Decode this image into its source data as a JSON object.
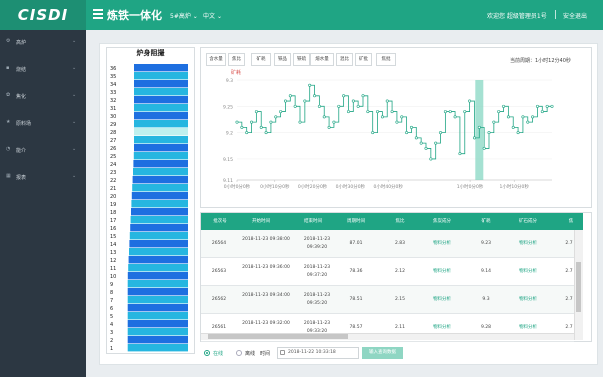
{
  "header": {
    "logo": "CISDI",
    "title": "炼铁一体化",
    "furnace_select": "5#高炉",
    "language_select": "中文",
    "welcome": "欢迎您 超级管理员1号",
    "logout": "安全退出"
  },
  "sidebar": {
    "items": [
      {
        "label": "高炉",
        "icon": "gear-icon"
      },
      {
        "label": "烧结",
        "icon": "square-icon"
      },
      {
        "label": "焦化",
        "icon": "cog-icon"
      },
      {
        "label": "原料场",
        "icon": "star-icon"
      },
      {
        "label": "能介",
        "icon": "pie-icon"
      },
      {
        "label": "报表",
        "icon": "table-icon"
      }
    ]
  },
  "furnace": {
    "title": "炉身阻撮",
    "levels": [
      "36",
      "35",
      "34",
      "33",
      "32",
      "31",
      "30",
      "29",
      "28",
      "27",
      "26",
      "25",
      "24",
      "23",
      "22",
      "21",
      "20",
      "19",
      "18",
      "17",
      "16",
      "15",
      "14",
      "13",
      "12",
      "11",
      "10",
      "9",
      "8",
      "7",
      "6",
      "5",
      "4",
      "3",
      "2",
      "1"
    ],
    "highlight_level": "28"
  },
  "chart": {
    "tabs": [
      "含水量",
      "焦比",
      "矿耗",
      "铁品",
      "铁硫",
      "熔水量",
      "混比",
      "矿批",
      "焦批"
    ],
    "cycle_label": "当前周期：1小时12分40秒",
    "series_name": "矿耗",
    "colors": {
      "line": "#1fa584",
      "marker_fill": "#ffffff",
      "highlight": "#7fd4bf",
      "header": "#1fa584"
    },
    "chart_data": {
      "type": "line",
      "x_ticks": [
        "0小时0分0秒",
        "0小时10分0秒",
        "0小时20分0秒",
        "0小时30分0秒",
        "0小时40分0秒",
        "1小时0分0秒",
        "1小时10分0秒"
      ],
      "y_ticks": [
        "9.3",
        "9.25",
        "9.2",
        "9.15",
        "9.11"
      ],
      "ylim": [
        9.11,
        9.3
      ],
      "values": [
        9.22,
        9.21,
        9.2,
        9.22,
        9.24,
        9.21,
        9.2,
        9.22,
        9.23,
        9.24,
        9.26,
        9.27,
        9.25,
        9.22,
        9.26,
        9.29,
        9.27,
        9.25,
        9.23,
        9.21,
        9.22,
        9.25,
        9.27,
        9.24,
        9.26,
        9.25,
        9.27,
        9.24,
        9.2,
        9.24,
        9.23,
        9.26,
        9.24,
        9.22,
        9.23,
        9.2,
        9.21,
        9.19,
        9.18,
        9.17,
        9.15,
        9.18,
        9.2,
        9.24,
        9.24,
        9.23,
        9.16,
        9.24,
        9.26,
        9.19,
        9.21,
        9.17,
        9.2,
        9.22,
        9.24,
        9.25,
        9.23,
        9.21,
        9.2,
        9.23,
        9.22,
        9.23,
        9.25,
        9.24,
        9.25,
        9.25
      ],
      "highlight_index": 50
    }
  },
  "table": {
    "columns": [
      "批次号",
      "开始时间",
      "结束时间",
      "周期时间",
      "焦比",
      "焦炭成分",
      "矿耗",
      "矿石成分",
      "焦"
    ],
    "rows": [
      {
        "batch": "26564",
        "start": "2018-11-23 09:38:00",
        "end": "2018-11-23 09:39:20",
        "period": "87.01",
        "ratio": "2.83",
        "coke": "物料分析",
        "ore_use": "9.23",
        "ore": "物料分析",
        "x": "2.7"
      },
      {
        "batch": "26563",
        "start": "2018-11-23 09:36:00",
        "end": "2018-11-23 09:37:20",
        "period": "78.36",
        "ratio": "2.12",
        "coke": "物料分析",
        "ore_use": "9.14",
        "ore": "物料分析",
        "x": "2.7"
      },
      {
        "batch": "26562",
        "start": "2018-11-23 09:34:00",
        "end": "2018-11-23 09:35:20",
        "period": "78.51",
        "ratio": "2.15",
        "coke": "物料分析",
        "ore_use": "9.3",
        "ore": "物料分析",
        "x": "2.7"
      },
      {
        "batch": "26561",
        "start": "2018-11-23 09:32:00",
        "end": "2018-11-23 09:33:20",
        "period": "78.57",
        "ratio": "2.11",
        "coke": "物料分析",
        "ore_use": "9.28",
        "ore": "物料分析",
        "x": "2.7"
      }
    ]
  },
  "controls": {
    "online_label": "在线",
    "offline_label": "离线",
    "time_label": "时间",
    "time_value": "2018-11-22 10:33:18",
    "query_label": "输入查询数据"
  }
}
